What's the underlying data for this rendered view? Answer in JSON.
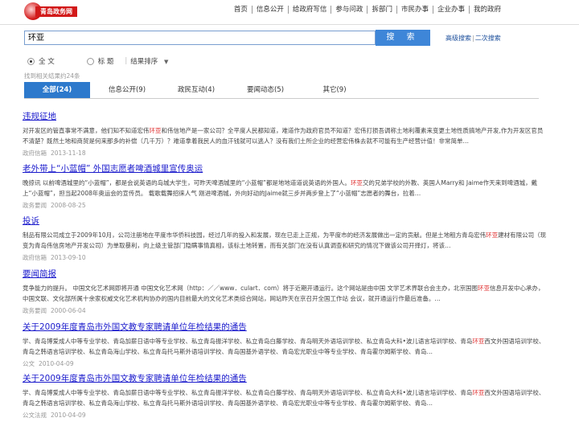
{
  "logo": {
    "text": "青岛政务网"
  },
  "topnav": [
    "首页",
    "信息公开",
    "给政府写信",
    "参与问政",
    "拆部门",
    "市民办事",
    "企业办事",
    "我的政府"
  ],
  "search": {
    "query": "环亚",
    "button": "搜 索",
    "advanced": "高级搜索",
    "sep": "|",
    "secondary": "二次搜索"
  },
  "options": {
    "full": "全 文",
    "title": "标 题",
    "sort": "结果排序"
  },
  "found_text": "找到相关结果约24条",
  "tabs": [
    {
      "label": "全部(24)"
    },
    {
      "label": "信息公开(9)"
    },
    {
      "label": "政民互动(4)"
    },
    {
      "label": "要闻动态(5)"
    },
    {
      "label": "其它(9)"
    }
  ],
  "highlight_term": "环亚",
  "results": [
    {
      "title": "违规征地",
      "snippet": "对开发区的管直事常不满意，他们知不知道宏伟环亚和伟信地产是一家公司？全平度人民都知道，难道作为政府官员不知道？宏伟打损吾调称土地利覆素来变更土地性质搞地产开发,作为开发区官员不清楚？既然土地和商贸是何来那多的补偿（几千万）？难道拿着我民人的血汗钱就可以逃人？没有我们土所企业的经营宏伟株去就不可能有生产经营计值！非常简单…",
      "source": "政府信箱",
      "date": "2013-11-18"
    },
    {
      "title": "老外带上“小蓝帽” 外国志愿者啤酒城里宣传奥运",
      "snippet": "晚掠讯 以前啤酒城里的“小蓝帽”，都是会说英语的岛城大学生，可昨天啤酒城里的“小蓝帽”都是地地道道说英语的外国人。环亚交的兄弟学校的外教、英国人Marry和 Jaime作天来到啤酒城，戴上“小蓝帽”，担当起2008年奥运会的宣传员。 载歌载舞招徕人气 刚进啤酒城，外向好动的Jaime就三步并两步登上了“小蓝帽”志愿者的舞台，拉着…",
      "source": "政务要闻",
      "date": "2008-08-25"
    },
    {
      "title": "投诉",
      "snippet": "制品有限公司成立于2009年10月，公司注册地在平度市华侨科技园，经过几年的投入和发展，现在已走上正规，为平度市的经济发展做出一定的贡献。但是土地租方青岛宏伟环亚建材有限公司（现变为青岛伟信房地产开发公司）为单取暴利，向上级主管部门隐瞒事情真相，该标土地转置，而有关部门在没有认真调查和研究的情况下做该公司开择灯，将该…",
      "source": "政府信箱",
      "date": "2013-09-10"
    },
    {
      "title": "要闻简报",
      "snippet": "竞争能力的提升。 中国文化艺术网即将开通 中国文化艺术网（http：／／www．culart．com）将于近期开通运行。这个网站是由中国 文学艺术界联合会主办，北京国图环亚信息开发中心承办，中国文联、文化部所属十余家权威文化艺术机构协办的国内目前最大的文化艺术类综合网站，网站昨天在京召开全国工作站 会议，就开通运行作最后准备。…",
      "source": "政务要闻",
      "date": "2000-06-04"
    },
    {
      "title": "关于2009年度青岛市外国文教专家聘请单位年检结果的通告",
      "snippet": "学、青岛博爱成人中等专业学校、青岛加薪日语中等专业学校、私立青岛振洋学校、私立青岛白藤学校、青岛明天外语培训学校、私立青岛大科•波儿语言培训学校、青岛环亚西文外国语培训学校、青岛之韩语言培训学校、私立青岛海山学校、私立青岛托马斯外语培训学校、青岛国基外语学校、青岛宏光职业中等专业学校、青岛霍尔姆斯学校、青岛…",
      "source": "公文",
      "date": "2010-04-09"
    },
    {
      "title": "关于2009年度青岛市外国文教专家聘请单位年检结果的通告",
      "snippet": "学、青岛博爱成人中等专业学校、青岛加薪日语中等专业学校、私立青岛振洋学校、私立青岛白藤学校、青岛明天外语培训学校、私立青岛大科•波儿语言培训学校、青岛环亚西文外国语培训学校、青岛之韩语言培训学校、私立青岛海山学校、私立青岛托马斯外语培训学校、青岛国基外语学校、青岛宏光职业中等专业学校、青岛霍尔姆斯学校、青岛…",
      "source": "公文法规",
      "date": "2010-04-09"
    }
  ]
}
